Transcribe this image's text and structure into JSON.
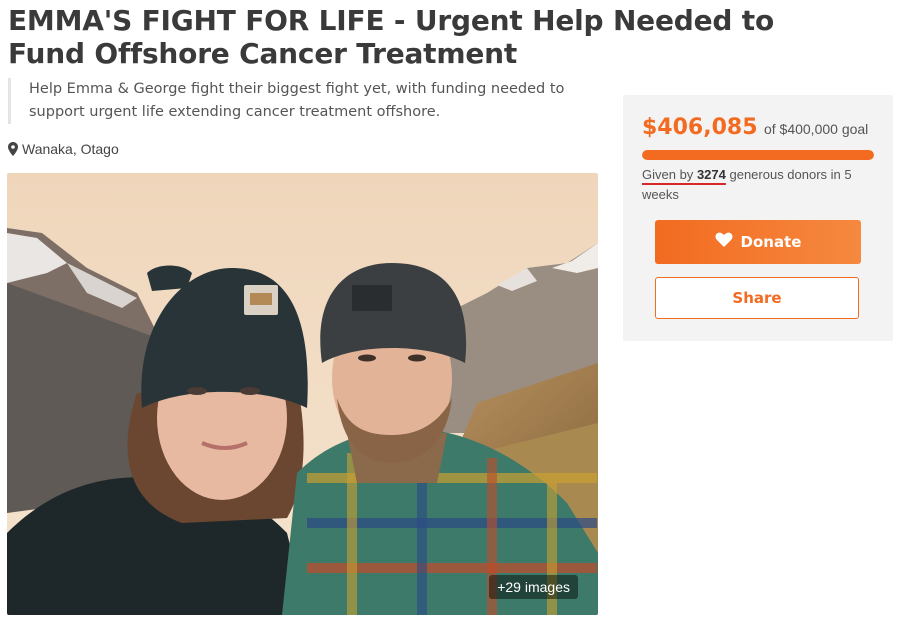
{
  "campaign": {
    "title": "EMMA'S FIGHT FOR LIFE - Urgent Help Needed to Fund Offshore Cancer Treatment",
    "subtitle": "Help Emma & George fight their biggest fight yet, with funding needed to support urgent life extending cancer treatment offshore.",
    "location": "Wanaka, Otago",
    "location_icon": "map-marker-icon",
    "images_badge": "+29 images"
  },
  "fundraising": {
    "raised": "$406,085",
    "goal_text": "of $400,000 goal",
    "progress_fraction": 1.0,
    "donors_prefix": "Given by",
    "donor_count": "3274",
    "donors_suffix": "generous donors in 5 weeks",
    "donate_label": "Donate",
    "donate_icon": "heart-icon",
    "share_label": "Share"
  },
  "colors": {
    "accent": "#f26b21",
    "panel_bg": "#f3f3f3",
    "title": "#3a3a3a"
  }
}
